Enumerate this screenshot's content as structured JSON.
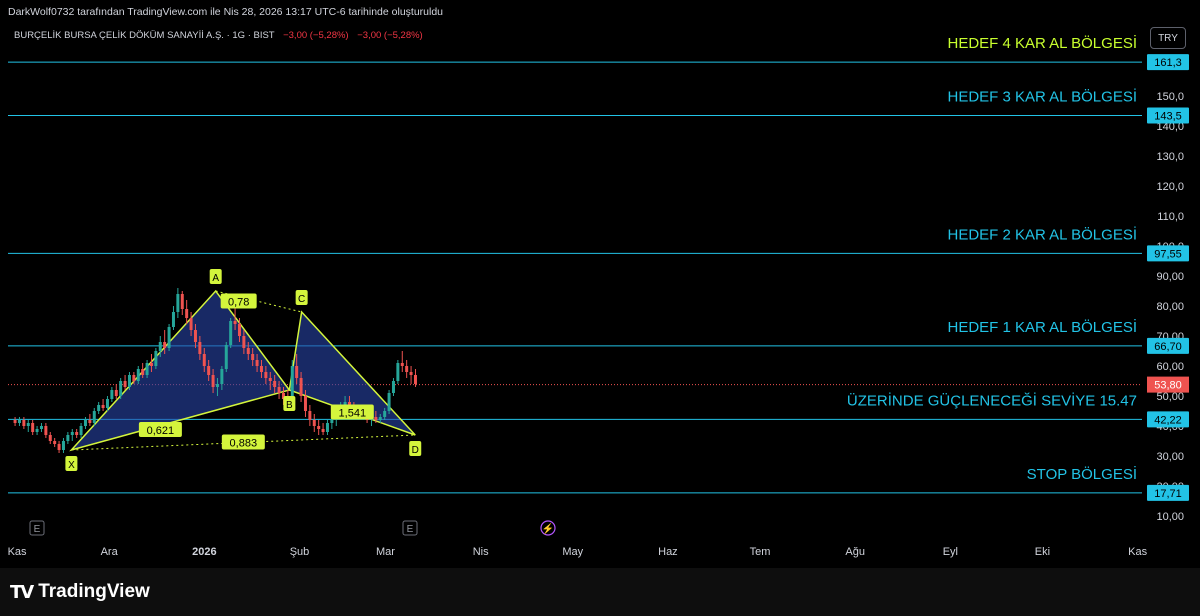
{
  "header": {
    "attribution": "DarkWolf0732 tarafından TradingView.com ile Nis 28, 2026 13:17 UTC-6 tarihinde oluşturuldu"
  },
  "symbol": {
    "name": "BURÇELİK BURSA ÇELİK DÖKÜM SANAYİİ A.Ş. · 1G · BIST",
    "change1": "−3,00 (−5,28%)",
    "change2": "−3,00 (−5,28%)"
  },
  "currency": "TRY",
  "footer": {
    "brand": "TradingView"
  },
  "colors": {
    "bull": "#26a69a",
    "bear": "#ef5350",
    "level": "#22c3e6",
    "pattern": "#d4f53c",
    "fill": "#2845a8"
  },
  "chart_data": {
    "type": "candlestick",
    "y_ticks": [
      "10,00",
      "20,00",
      "30,00",
      "40,00",
      "50,00",
      "60,00",
      "70,00",
      "80,00",
      "90,00",
      "100,0",
      "110,0",
      "120,0",
      "130,0",
      "140,0",
      "150,0"
    ],
    "ylim": [
      5,
      173
    ],
    "x_ticks": [
      "Kas",
      "Ara",
      "2026",
      "Şub",
      "Mar",
      "Nis",
      "May",
      "Haz",
      "Tem",
      "Ağu",
      "Eyl",
      "Eki",
      "Kas"
    ],
    "current_price": {
      "value": 53.8,
      "label": "53,80"
    },
    "levels": [
      {
        "value": 161.3,
        "label": "161,3",
        "text": "HEDEF 4 KAR AL BÖLGESİ",
        "text_color": "#c8ff2e"
      },
      {
        "value": 143.5,
        "label": "143,5",
        "text": "HEDEF 3 KAR AL BÖLGESİ",
        "text_color": "#22c3e6"
      },
      {
        "value": 97.55,
        "label": "97,55",
        "text": "HEDEF 2 KAR AL BÖLGESİ",
        "text_color": "#22c3e6"
      },
      {
        "value": 66.7,
        "label": "66,70",
        "text": "HEDEF 1 KAR AL BÖLGESİ",
        "text_color": "#22c3e6"
      },
      {
        "value": 42.22,
        "label": "42,22",
        "text": "ÜZERİNDE GÜÇLENECEĞİ SEVİYE  15.47",
        "text_color": "#22c3e6"
      },
      {
        "value": 17.71,
        "label": "17,71",
        "text": "STOP BÖLGESİ",
        "text_color": "#22c3e6"
      }
    ],
    "harmonic": {
      "points": [
        {
          "label": "X",
          "date": "2025-11-20",
          "price": 32
        },
        {
          "label": "A",
          "date": "2026-01-06",
          "price": 85
        },
        {
          "label": "B",
          "date": "2026-01-30",
          "price": 52
        },
        {
          "label": "C",
          "date": "2026-02-03",
          "price": 78
        },
        {
          "label": "D",
          "date": "2026-03-12",
          "price": 37
        }
      ],
      "ratios": [
        {
          "label": "0,621"
        },
        {
          "label": "0,78"
        },
        {
          "label": "1,541"
        },
        {
          "label": "0,883"
        }
      ]
    },
    "event_markers": [
      "E",
      "E",
      "⚡"
    ],
    "candles_start": "2025-11-01",
    "candles": [
      [
        42,
        43,
        40,
        41
      ],
      [
        41,
        43,
        40,
        42
      ],
      [
        42,
        43,
        39,
        40
      ],
      [
        40,
        42,
        38,
        41
      ],
      [
        41,
        42,
        37,
        38
      ],
      [
        38,
        40,
        37,
        39
      ],
      [
        39,
        41,
        38,
        40
      ],
      [
        40,
        41,
        36,
        37
      ],
      [
        37,
        38,
        34,
        35
      ],
      [
        35,
        36,
        33,
        34
      ],
      [
        34,
        35,
        31,
        32
      ],
      [
        32,
        36,
        31,
        35
      ],
      [
        35,
        38,
        34,
        37
      ],
      [
        37,
        39,
        35,
        38
      ],
      [
        38,
        39,
        36,
        37
      ],
      [
        37,
        41,
        36,
        40
      ],
      [
        40,
        43,
        39,
        42
      ],
      [
        42,
        44,
        40,
        41
      ],
      [
        41,
        46,
        40,
        45
      ],
      [
        45,
        48,
        44,
        47
      ],
      [
        47,
        49,
        45,
        46
      ],
      [
        46,
        50,
        45,
        49
      ],
      [
        49,
        53,
        48,
        52
      ],
      [
        52,
        54,
        49,
        50
      ],
      [
        50,
        56,
        49,
        55
      ],
      [
        55,
        57,
        52,
        53
      ],
      [
        53,
        58,
        52,
        57
      ],
      [
        57,
        58,
        54,
        55
      ],
      [
        55,
        60,
        54,
        59
      ],
      [
        59,
        61,
        56,
        57
      ],
      [
        57,
        62,
        56,
        61
      ],
      [
        61,
        64,
        58,
        60
      ],
      [
        60,
        66,
        59,
        65
      ],
      [
        65,
        70,
        63,
        68
      ],
      [
        68,
        72,
        64,
        66
      ],
      [
        66,
        74,
        65,
        73
      ],
      [
        73,
        80,
        72,
        78
      ],
      [
        78,
        86,
        76,
        84
      ],
      [
        84,
        85,
        77,
        79
      ],
      [
        79,
        82,
        74,
        76
      ],
      [
        76,
        78,
        70,
        72
      ],
      [
        72,
        74,
        66,
        68
      ],
      [
        68,
        70,
        62,
        64
      ],
      [
        64,
        66,
        58,
        60
      ],
      [
        60,
        62,
        55,
        57
      ],
      [
        57,
        59,
        51,
        53
      ],
      [
        53,
        56,
        50,
        54
      ],
      [
        54,
        60,
        52,
        59
      ],
      [
        59,
        68,
        58,
        67
      ],
      [
        67,
        76,
        66,
        75
      ],
      [
        75,
        80,
        72,
        74
      ],
      [
        74,
        76,
        68,
        70
      ],
      [
        70,
        72,
        64,
        66
      ],
      [
        66,
        68,
        62,
        64
      ],
      [
        64,
        66,
        60,
        62
      ],
      [
        62,
        64,
        58,
        60
      ],
      [
        60,
        62,
        56,
        58
      ],
      [
        58,
        60,
        54,
        56
      ],
      [
        56,
        58,
        52,
        55
      ],
      [
        55,
        57,
        51,
        53
      ],
      [
        53,
        55,
        49,
        51
      ],
      [
        51,
        53,
        47,
        49
      ],
      [
        49,
        52,
        45,
        47
      ],
      [
        47,
        62,
        46,
        60
      ],
      [
        60,
        64,
        54,
        56
      ],
      [
        56,
        58,
        48,
        50
      ],
      [
        50,
        52,
        43,
        45
      ],
      [
        45,
        47,
        40,
        42
      ],
      [
        42,
        44,
        38,
        40
      ],
      [
        40,
        42,
        37,
        39
      ],
      [
        39,
        41,
        37,
        38
      ],
      [
        38,
        42,
        37,
        41
      ],
      [
        41,
        43,
        39,
        42
      ],
      [
        42,
        45,
        40,
        44
      ],
      [
        44,
        48,
        43,
        47
      ],
      [
        47,
        50,
        45,
        48
      ],
      [
        48,
        50,
        45,
        46
      ],
      [
        46,
        48,
        43,
        44
      ],
      [
        44,
        46,
        42,
        45
      ],
      [
        45,
        47,
        43,
        44
      ],
      [
        44,
        46,
        41,
        42
      ],
      [
        42,
        44,
        40,
        43
      ],
      [
        43,
        45,
        41,
        42
      ],
      [
        42,
        44,
        41,
        43
      ],
      [
        43,
        46,
        42,
        45
      ],
      [
        45,
        52,
        44,
        51
      ],
      [
        51,
        56,
        50,
        55
      ],
      [
        55,
        62,
        54,
        61
      ],
      [
        61,
        65,
        58,
        60
      ],
      [
        60,
        62,
        56,
        58
      ],
      [
        58,
        60,
        54,
        57
      ],
      [
        57,
        59,
        53,
        54
      ]
    ]
  }
}
